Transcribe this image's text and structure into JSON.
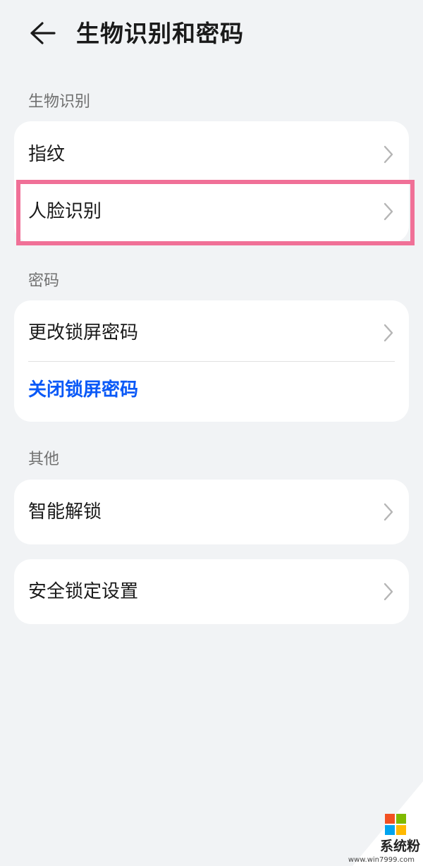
{
  "header": {
    "title": "生物识别和密码",
    "back_icon": "arrow-left-icon"
  },
  "sections": [
    {
      "label": "生物识别",
      "items": [
        {
          "label": "指纹"
        },
        {
          "label": "人脸识别"
        }
      ]
    },
    {
      "label": "密码",
      "items": [
        {
          "label": "更改锁屏密码"
        },
        {
          "label": "关闭锁屏密码",
          "link_color": "#0A59F7"
        }
      ]
    },
    {
      "label": "其他",
      "items": [
        {
          "label": "智能解锁"
        }
      ]
    },
    {
      "items": [
        {
          "label": "安全锁定设置"
        }
      ]
    }
  ],
  "chevron_icon": "chevron-right-icon",
  "highlight_color": "#F07097",
  "watermark": {
    "name": "系统粉",
    "url": "www.win7999.com",
    "logo_colors": [
      "#F25022",
      "#7FBA00",
      "#00A4EF",
      "#FFB900"
    ]
  }
}
